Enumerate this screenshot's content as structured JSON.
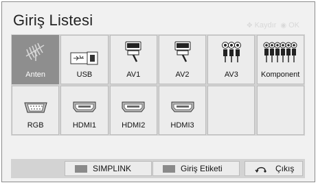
{
  "title": "Giriş Listesi",
  "hints": {
    "move": "Kaydır",
    "ok": "OK"
  },
  "inputs": [
    {
      "label": "Anten",
      "icon": "antenna-icon",
      "selected": true
    },
    {
      "label": "USB",
      "icon": "usb-icon",
      "selected": false
    },
    {
      "label": "AV1",
      "icon": "scart-icon",
      "selected": false
    },
    {
      "label": "AV2",
      "icon": "scart-icon",
      "selected": false
    },
    {
      "label": "AV3",
      "icon": "rca-icon",
      "selected": false
    },
    {
      "label": "Komponent",
      "icon": "component-icon",
      "selected": false
    },
    {
      "label": "RGB",
      "icon": "vga-icon",
      "selected": false
    },
    {
      "label": "HDMI1",
      "icon": "hdmi-icon",
      "selected": false
    },
    {
      "label": "HDMI2",
      "icon": "hdmi-icon",
      "selected": false
    },
    {
      "label": "HDMI3",
      "icon": "hdmi-icon",
      "selected": false
    },
    {
      "label": "",
      "icon": "",
      "selected": false
    },
    {
      "label": "",
      "icon": "",
      "selected": false
    }
  ],
  "buttons": {
    "simplink": "SIMPLINK",
    "input_label": "Giriş Etiketi",
    "exit": "Çıkış"
  },
  "colors": {
    "selected": "#8e8e8e",
    "cell": "#ececec",
    "grid_bg": "#d3d3d3"
  }
}
